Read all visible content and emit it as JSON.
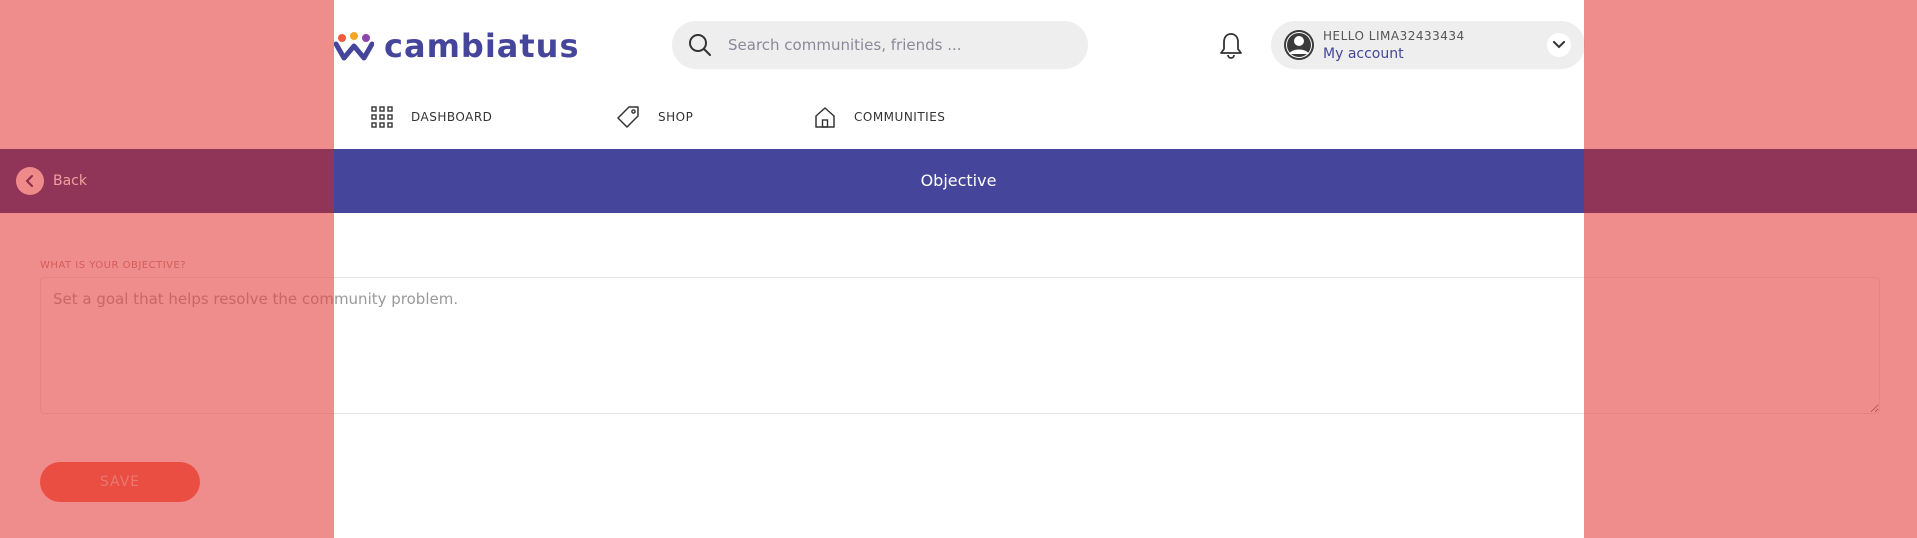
{
  "header": {
    "brand": "cambiatus",
    "search": {
      "placeholder": "Search communities, friends ..."
    },
    "account": {
      "greeting": "HELLO LIMA32433434",
      "link": "My account"
    }
  },
  "nav": {
    "items": [
      {
        "label": "DASHBOARD",
        "icon": "grid-icon"
      },
      {
        "label": "SHOP",
        "icon": "tag-icon"
      },
      {
        "label": "COMMUNITIES",
        "icon": "home-icon"
      }
    ]
  },
  "titlebar": {
    "back_label": "Back",
    "title": "Objective"
  },
  "form": {
    "label": "WHAT IS YOUR OBJECTIVE?",
    "placeholder": "Set a goal that helps resolve the community problem.",
    "save_label": "SAVE"
  },
  "colors": {
    "brand": "#45469b",
    "accent": "#f15a3a",
    "overlay": "#e54747"
  }
}
